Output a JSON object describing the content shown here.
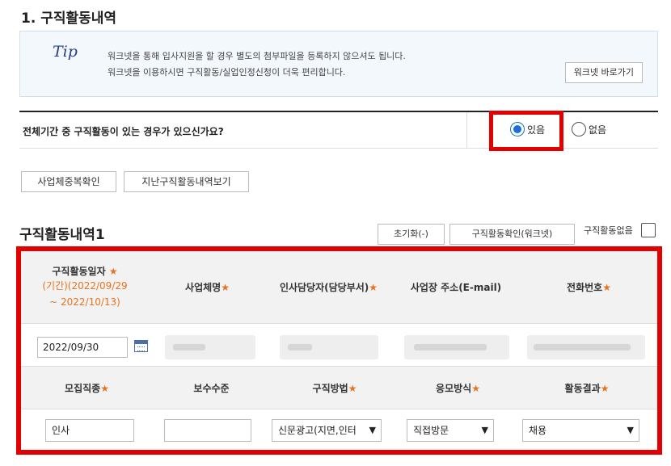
{
  "section": {
    "title": "1. 구직활동내역"
  },
  "tip": {
    "label": "Tip",
    "line1": "워크넷을 통해 입사지원을 할 경우 별도의 첨부파일을 등록하지 않으셔도 됩니다.",
    "line2": "워크넷을 이용하시면 구직활동/실업인정신청이 더욱 편리합니다.",
    "link_label": "워크넷 바로가기"
  },
  "question": {
    "text": "전체기간 중 구직활동이 있는 경우가 있으신가요?",
    "options": [
      {
        "label": "있음",
        "selected": true
      },
      {
        "label": "없음",
        "selected": false
      }
    ]
  },
  "buttons": {
    "dup_check": "사업체중복확인",
    "past_history": "지난구직활동내역보기"
  },
  "activity": {
    "title": "구직활동내역1",
    "reset_label": "초기화(-)",
    "check_label": "구직활동확인(워크넷)",
    "none_label": "구직활동없음"
  },
  "table": {
    "headers1": {
      "date": "구직활동일자",
      "period_line1": "(기간)(2022/09/29",
      "period_line2": "~ 2022/10/13)",
      "company": "사업체명",
      "manager": "인사담당자(담당부서)",
      "address": "사업장 주소(E-mail)",
      "phone": "전화번호"
    },
    "headers2": {
      "job_type": "모집직종",
      "salary": "보수수준",
      "method": "구직방법",
      "apply": "응모방식",
      "result": "활동결과"
    },
    "row1": {
      "date": "2022/09/30"
    },
    "row2": {
      "job_type": "인사",
      "salary": "",
      "method": "신문광고(지면,인터",
      "apply": "직접방문",
      "result": "채용"
    },
    "required_mark": "★"
  },
  "colors": {
    "highlight": "#e30000",
    "accent": "#1a6fe0",
    "required": "#e8731e"
  }
}
